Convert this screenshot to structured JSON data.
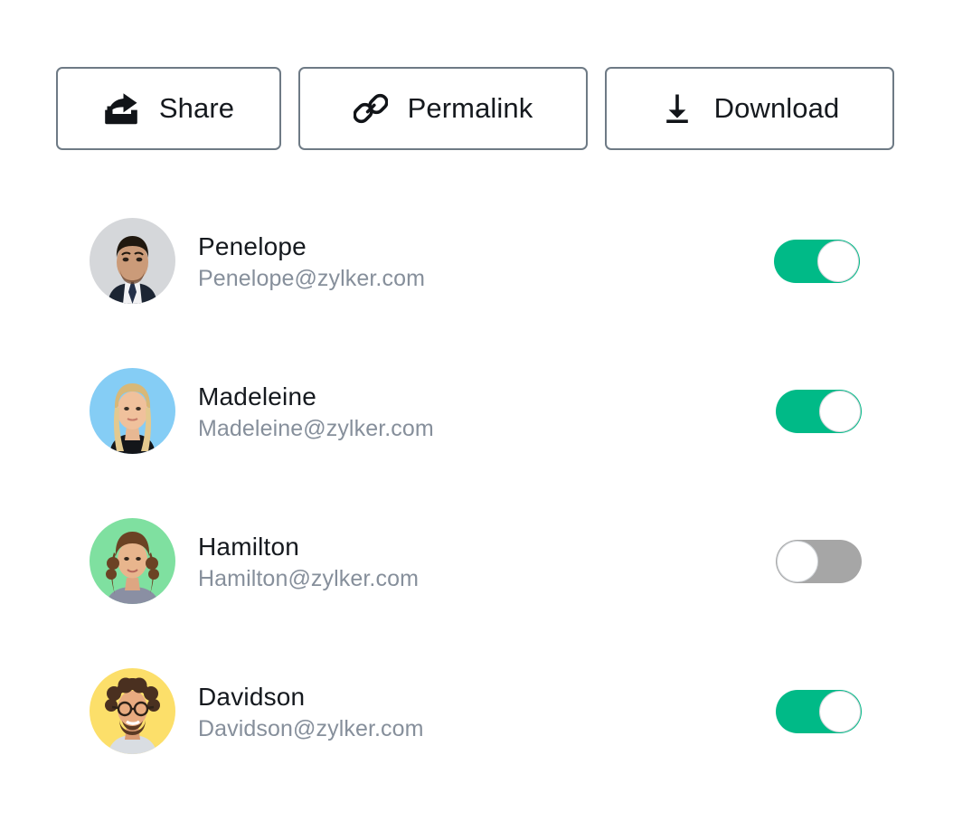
{
  "toolbar": {
    "buttons": [
      {
        "label": "Share",
        "icon": "share-icon"
      },
      {
        "label": "Permalink",
        "icon": "link-icon"
      },
      {
        "label": "Download",
        "icon": "download-icon"
      }
    ]
  },
  "colors": {
    "toggle_on": "#00ba87",
    "toggle_off": "#a6a6a6",
    "knob": "#ffffff",
    "button_border": "#6e7a85",
    "name_text": "#15191e",
    "email_text": "#868f9b"
  },
  "users": [
    {
      "name": "Penelope",
      "email": "Penelope@zylker.com",
      "toggle": "on",
      "toggle_state_label": "On",
      "avatar_bg": "#d5d7da",
      "avatar_alt": "portrait-photo"
    },
    {
      "name": "Madeleine",
      "email": "Madeleine@zylker.com",
      "toggle": "on",
      "toggle_state_label": "On",
      "avatar_bg": "#85cdf5",
      "avatar_alt": "portrait-photo"
    },
    {
      "name": "Hamilton",
      "email": "Hamilton@zylker.com",
      "toggle": "off",
      "toggle_state_label": "Off",
      "avatar_bg": "#7fe0a0",
      "avatar_alt": "portrait-photo"
    },
    {
      "name": "Davidson",
      "email": "Davidson@zylker.com",
      "toggle": "on",
      "toggle_state_label": "On",
      "avatar_bg": "#fcdf6a",
      "avatar_alt": "portrait-photo"
    }
  ]
}
